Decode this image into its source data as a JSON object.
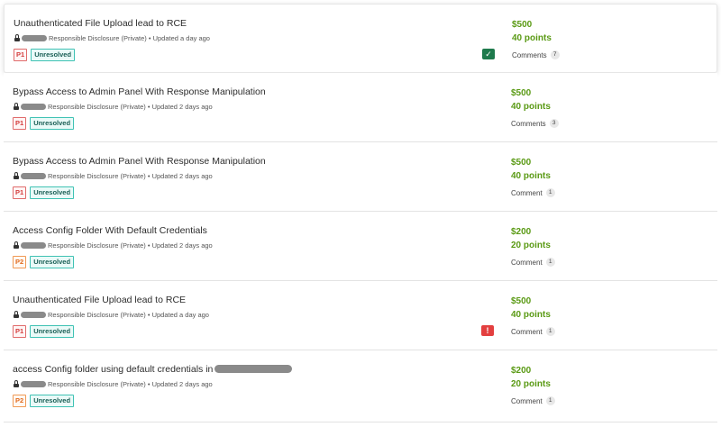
{
  "reports": [
    {
      "title": "Unauthenticated File Upload lead to RCE",
      "meta": "Responsible Disclosure (Private) • Updated a day ago",
      "severity": "P1",
      "status": "Unresolved",
      "bounty": "$500",
      "points": "40 points",
      "comments_label": "Comments",
      "comments_count": "7",
      "flag": "check-icon",
      "selected": true
    },
    {
      "title": "Bypass Access to Admin Panel With Response Manipulation",
      "meta": "Responsible Disclosure (Private) • Updated 2 days ago",
      "severity": "P1",
      "status": "Unresolved",
      "bounty": "$500",
      "points": "40 points",
      "comments_label": "Comments",
      "comments_count": "3",
      "flag": null
    },
    {
      "title": "Bypass Access to Admin Panel With Response Manipulation",
      "meta": "Responsible Disclosure (Private) • Updated 2 days ago",
      "severity": "P1",
      "status": "Unresolved",
      "bounty": "$500",
      "points": "40 points",
      "comments_label": "Comment",
      "comments_count": "1",
      "flag": null
    },
    {
      "title": "Access Config Folder With Default Credentials",
      "meta": "Responsible Disclosure (Private) • Updated 2 days ago",
      "severity": "P2",
      "status": "Unresolved",
      "bounty": "$200",
      "points": "20 points",
      "comments_label": "Comment",
      "comments_count": "1",
      "flag": null
    },
    {
      "title": "Unauthenticated File Upload lead to RCE",
      "meta": "Responsible Disclosure (Private) • Updated a day ago",
      "severity": "P1",
      "status": "Unresolved",
      "bounty": "$500",
      "points": "40 points",
      "comments_label": "Comment",
      "comments_count": "1",
      "flag": "alert-icon"
    },
    {
      "title": "access Config folder using default credentials in",
      "title_redacted": true,
      "meta": "Responsible Disclosure (Private) • Updated 2 days ago",
      "severity": "P2",
      "status": "Unresolved",
      "bounty": "$200",
      "points": "20 points",
      "comments_label": "Comment",
      "comments_count": "1",
      "flag": null
    }
  ],
  "colors": {
    "reward_green": "#5a9a14",
    "p1_red": "#d33d3d",
    "p2_orange": "#e06b1f",
    "status_teal": "#3fc2b4",
    "flag_ok": "#1e7a4c",
    "flag_alert": "#e33f3f"
  },
  "flag_glyphs": {
    "check-icon": "✓",
    "alert-icon": "!"
  }
}
